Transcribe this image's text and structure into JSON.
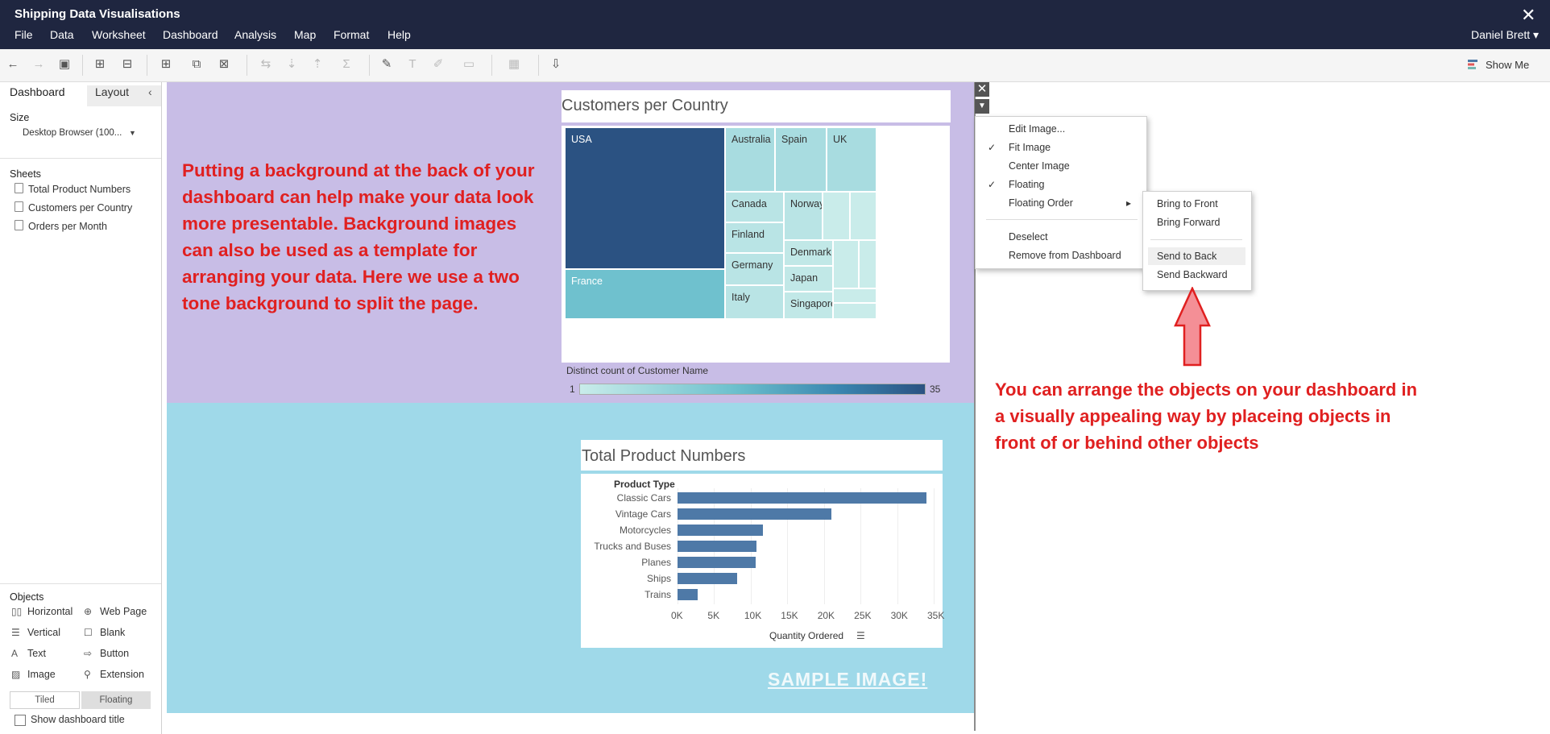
{
  "app": {
    "title": "Shipping Data Visualisations",
    "close_glyph": "✕",
    "user": "Daniel Brett ▾"
  },
  "menu": [
    "File",
    "Data",
    "Worksheet",
    "Dashboard",
    "Analysis",
    "Map",
    "Format",
    "Help"
  ],
  "toolbar": {
    "show_me": "Show Me"
  },
  "left_pane": {
    "tabs": {
      "dashboard": "Dashboard",
      "layout": "Layout"
    },
    "collapse_glyph": "‹",
    "size_title": "Size",
    "size_value": "Desktop Browser (100...",
    "sheets_title": "Sheets",
    "sheets": [
      "Total Product Numbers",
      "Customers per Country",
      "Orders per Month"
    ],
    "objects_title": "Objects",
    "objects": [
      {
        "label": "Horizontal",
        "icon": "horizontal-icon",
        "glyph": "▯▯"
      },
      {
        "label": "Web Page",
        "icon": "globe-icon",
        "glyph": "⊕"
      },
      {
        "label": "Vertical",
        "icon": "vertical-icon",
        "glyph": "☰"
      },
      {
        "label": "Blank",
        "icon": "blank-icon",
        "glyph": "☐"
      },
      {
        "label": "Text",
        "icon": "text-icon",
        "glyph": "A"
      },
      {
        "label": "Button",
        "icon": "button-icon",
        "glyph": "⇨"
      },
      {
        "label": "Image",
        "icon": "image-icon",
        "glyph": "▨"
      },
      {
        "label": "Extension",
        "icon": "extension-icon",
        "glyph": "⚲"
      }
    ],
    "tiled": "Tiled",
    "floating": "Floating",
    "show_title": "Show dashboard title"
  },
  "dashboard": {
    "intro_text": "Putting a background at the back of your dashboard can help make your data look more presentable.  Background images can also be used as a template for arranging your data.  Here we use a two tone background to split the page.",
    "sample_image": "SAMPLE IMAGE!",
    "colors": {
      "top_background": "#c8bde6",
      "bottom_background": "#9fd9e9",
      "bar": "#4e79a7",
      "text_red": "#e02020"
    }
  },
  "floating_controls": {
    "close_glyph": "✕",
    "menu_glyph": "▼"
  },
  "context_menu": {
    "items": [
      "Edit Image...",
      "Fit Image",
      "Center Image",
      "Floating",
      "Floating Order",
      "Deselect",
      "Remove from Dashboard"
    ],
    "checked": [
      "Fit Image",
      "Floating"
    ],
    "submenu_glyph": "▸",
    "check_glyph": "✓"
  },
  "submenu": {
    "items": [
      "Bring to Front",
      "Bring Forward",
      "Send to Back",
      "Send Backward"
    ],
    "highlighted": "Send to Back"
  },
  "annotation": {
    "text": "You can arrange the objects on your dashboard in a visually appealing way by placeing objects in front of or behind other objects"
  },
  "chart_data": [
    {
      "type": "treemap",
      "title": "Customers per Country",
      "legend": {
        "title": "Distinct count of Customer Name",
        "min": 1,
        "max": 35,
        "colors": [
          "#c9ecea",
          "#6cc0cd",
          "#3a86b0",
          "#2b5282"
        ]
      },
      "cells": [
        {
          "label": "USA",
          "value": 35
        },
        {
          "label": "France",
          "value": 12
        },
        {
          "label": "Australia",
          "value": 5
        },
        {
          "label": "Spain",
          "value": 5
        },
        {
          "label": "UK",
          "value": 5
        },
        {
          "label": "Canada",
          "value": 3
        },
        {
          "label": "Norway",
          "value": 3
        },
        {
          "label": "Finland",
          "value": 3
        },
        {
          "label": "Germany",
          "value": 3
        },
        {
          "label": "Italy",
          "value": 3
        },
        {
          "label": "Denmark",
          "value": 2
        },
        {
          "label": "Japan",
          "value": 2
        },
        {
          "label": "Singapore",
          "value": 2
        },
        {
          "label": "",
          "value": 1
        },
        {
          "label": "",
          "value": 1
        },
        {
          "label": "",
          "value": 1
        },
        {
          "label": "",
          "value": 1
        },
        {
          "label": "",
          "value": 1
        },
        {
          "label": "",
          "value": 1
        }
      ]
    },
    {
      "type": "bar",
      "orientation": "horizontal",
      "title": "Total Product Numbers",
      "category_header": "Product Type",
      "xlabel": "Quantity Ordered",
      "categories": [
        "Classic Cars",
        "Vintage Cars",
        "Motorcycles",
        "Trucks and Buses",
        "Planes",
        "Ships",
        "Trains"
      ],
      "values": [
        33992,
        21069,
        11663,
        10777,
        10727,
        8127,
        2712
      ],
      "xlim": [
        0,
        35000
      ],
      "ticks": [
        0,
        5000,
        10000,
        15000,
        20000,
        25000,
        30000,
        35000
      ],
      "tick_labels": [
        "0K",
        "5K",
        "10K",
        "15K",
        "20K",
        "25K",
        "30K",
        "35K"
      ],
      "grid": true
    }
  ]
}
